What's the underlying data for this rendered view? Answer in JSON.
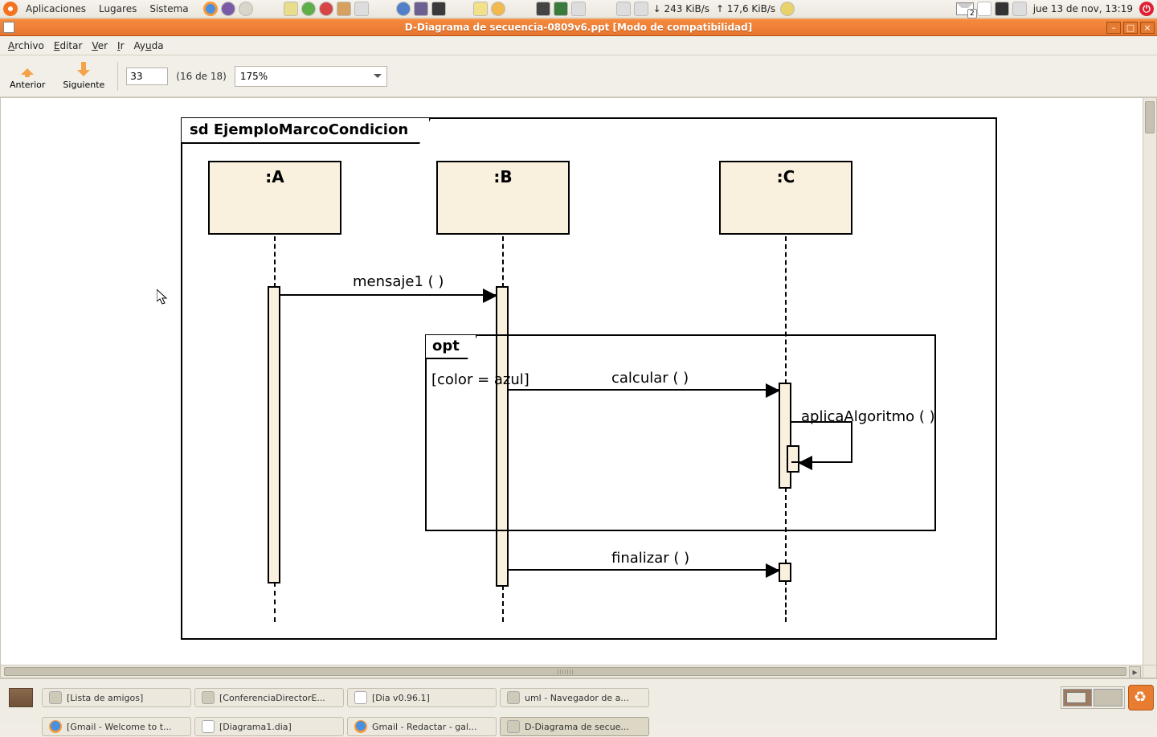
{
  "panel": {
    "apps": "Aplicaciones",
    "places": "Lugares",
    "system": "Sistema",
    "net_down": "↓ 243 KiB/s",
    "net_up": "↑ 17,6 KiB/s",
    "mail_badge": "2",
    "clock": "jue 13 de nov, 13:19"
  },
  "window": {
    "title": "D-Diagrama de secuencia-0809v6.ppt [Modo de compatibilidad]"
  },
  "menubar": {
    "archivo": "Archivo",
    "editar": "Editar",
    "ver": "Ver",
    "ir": "Ir",
    "ayuda": "Ayuda"
  },
  "toolbar": {
    "prev": "Anterior",
    "next": "Siguiente",
    "page": "33",
    "page_count": "(16 de 18)",
    "zoom": "175%"
  },
  "diagram": {
    "title": "sd  EjemploMarcoCondicion",
    "lifelines": {
      "a": ":A",
      "b": ":B",
      "c": ":C"
    },
    "msg1": "mensaje1 ( )",
    "opt_label": "opt",
    "guard": "[color = azul]",
    "calcular": "calcular ( )",
    "aplica": "aplicaAlgoritmo ( )",
    "finalizar": "finalizar ( )"
  },
  "taskbar": {
    "r1": {
      "t1": "[Lista de amigos]",
      "t2": "[ConferenciaDirectorE...",
      "t3": "[Dia v0.96.1]",
      "t4": "uml - Navegador de a..."
    },
    "r2": {
      "t1": "[Gmail - Welcome to t...",
      "t2": "[Diagrama1.dia]",
      "t3": "Gmail - Redactar - gal...",
      "t4": "D-Diagrama de secue..."
    }
  }
}
